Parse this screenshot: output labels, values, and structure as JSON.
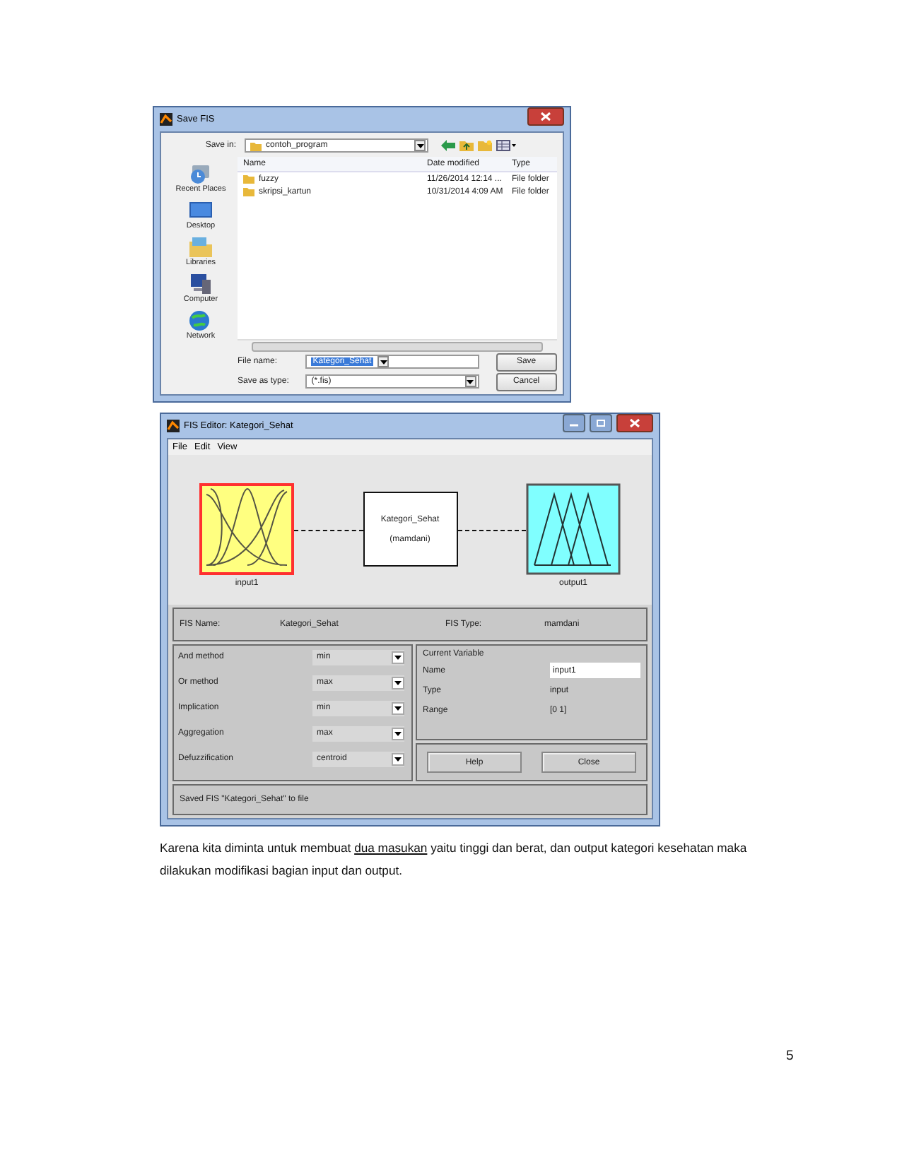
{
  "save_dialog": {
    "title": "Save FIS",
    "save_in_label": "Save in:",
    "save_in": "contoh_program",
    "places": [
      {
        "label": "Recent Places"
      },
      {
        "label": "Desktop"
      },
      {
        "label": "Libraries"
      },
      {
        "label": "Computer"
      },
      {
        "label": "Network"
      }
    ],
    "columns": [
      "Name",
      "Date modified",
      "Type"
    ],
    "files": [
      {
        "name": "fuzzy",
        "date": "11/26/2014 12:14 ...",
        "type": "File folder"
      },
      {
        "name": "skripsi_kartun",
        "date": "10/31/2014 4:09 AM",
        "type": "File folder"
      }
    ],
    "file_name_label": "File name:",
    "file_name": "Kategori_Sehat",
    "save_as_type_label": "Save as type:",
    "save_as_type": "(*.fis)",
    "buttons": [
      "Save",
      "Cancel"
    ]
  },
  "fis_editor": {
    "title": "FIS Editor: Kategori_Sehat",
    "menu": [
      "File",
      "Edit",
      "View"
    ],
    "input": {
      "label": "input1",
      "selected": true
    },
    "system": {
      "name": "Kategori_Sehat",
      "type": "(mamdani)"
    },
    "output": {
      "label": "output1",
      "selected": false
    },
    "fis_name_label": "FIS Name:",
    "fis_name": "Kategori_Sehat",
    "fis_type_label": "FIS Type:",
    "fis_type": "mamdani",
    "methods": [
      {
        "label": "And method",
        "value": "min"
      },
      {
        "label": "Or method",
        "value": "max"
      },
      {
        "label": "Implication",
        "value": "min"
      },
      {
        "label": "Aggregation",
        "value": "max"
      },
      {
        "label": "Defuzzification",
        "value": "centroid"
      }
    ],
    "current_variable": {
      "title": "Current Variable",
      "fields": [
        {
          "label": "Name",
          "value": "input1",
          "kind": "field"
        },
        {
          "label": "Type",
          "value": "input",
          "kind": "text"
        },
        {
          "label": "Range",
          "value": "[0 1]",
          "kind": "text"
        }
      ]
    },
    "buttons": [
      "Help",
      "Close"
    ],
    "status": "Saved FIS \"Kategori_Sehat\" to file"
  },
  "paragraph": {
    "before": "Karena kita diminta untuk membuat  ",
    "underlined": "dua masukan",
    "after": " yaitu tinggi dan berat, dan output kategori kesehatan  maka dilakukan modifikasi bagian input dan output."
  },
  "page_number": "5"
}
